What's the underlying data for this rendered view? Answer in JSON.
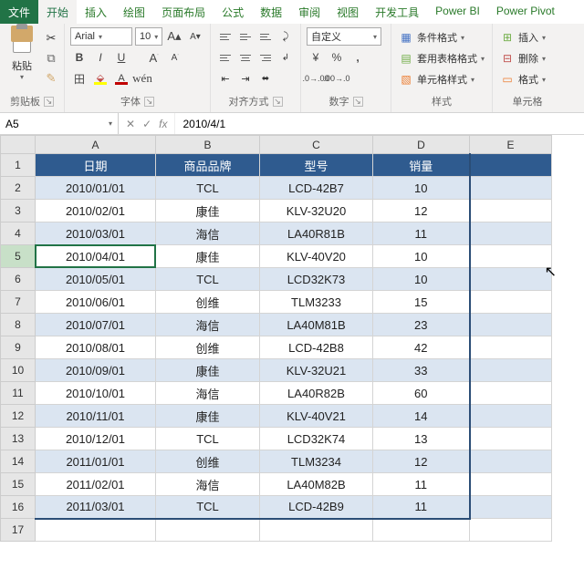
{
  "tabs": {
    "file": "文件",
    "home": "开始",
    "insert": "插入",
    "draw": "绘图",
    "layout": "页面布局",
    "formula": "公式",
    "data": "数据",
    "review": "审阅",
    "view": "视图",
    "dev": "开发工具",
    "pbi": "Power BI",
    "ppivot": "Power Pivot"
  },
  "ribbon": {
    "clipboard": {
      "label": "剪贴板",
      "paste": "粘贴"
    },
    "font": {
      "label": "字体",
      "name": "Arial",
      "size": "10",
      "bold": "B",
      "italic": "I",
      "underline": "U",
      "border": "田",
      "bg": "A",
      "fg": "A",
      "grow": "A",
      "shrink": "A",
      "pinyin": "wén"
    },
    "align": {
      "label": "对齐方式"
    },
    "number": {
      "label": "数字",
      "format": "自定义",
      "pct": "%",
      "comma": ",",
      "inc": ".0",
      "dec": ".00"
    },
    "styles": {
      "label": "样式",
      "cond": "条件格式",
      "tbl": "套用表格格式",
      "cell": "单元格样式"
    },
    "cells": {
      "label": "单元格",
      "insert": "插入",
      "delete": "删除",
      "format": "格式"
    }
  },
  "fx": {
    "ref": "A5",
    "fx": "fx",
    "value": "2010/4/1",
    "x": "✕",
    "chk": "✓"
  },
  "cols": [
    "A",
    "B",
    "C",
    "D",
    "E"
  ],
  "headers": {
    "A": "日期",
    "B": "商品品牌",
    "C": "型号",
    "D": "销量"
  },
  "rows": [
    {
      "n": "2",
      "A": "2010/01/01",
      "B": "TCL",
      "C": "LCD-42B7",
      "D": "10"
    },
    {
      "n": "3",
      "A": "2010/02/01",
      "B": "康佳",
      "C": "KLV-32U20",
      "D": "12"
    },
    {
      "n": "4",
      "A": "2010/03/01",
      "B": "海信",
      "C": "LA40R81B",
      "D": "11"
    },
    {
      "n": "5",
      "A": "2010/04/01",
      "B": "康佳",
      "C": "KLV-40V20",
      "D": "10"
    },
    {
      "n": "6",
      "A": "2010/05/01",
      "B": "TCL",
      "C": "LCD32K73",
      "D": "10"
    },
    {
      "n": "7",
      "A": "2010/06/01",
      "B": "创维",
      "C": "TLM3233",
      "D": "15"
    },
    {
      "n": "8",
      "A": "2010/07/01",
      "B": "海信",
      "C": "LA40M81B",
      "D": "23"
    },
    {
      "n": "9",
      "A": "2010/08/01",
      "B": "创维",
      "C": "LCD-42B8",
      "D": "42"
    },
    {
      "n": "10",
      "A": "2010/09/01",
      "B": "康佳",
      "C": "KLV-32U21",
      "D": "33"
    },
    {
      "n": "11",
      "A": "2010/10/01",
      "B": "海信",
      "C": "LA40R82B",
      "D": "60"
    },
    {
      "n": "12",
      "A": "2010/11/01",
      "B": "康佳",
      "C": "KLV-40V21",
      "D": "14"
    },
    {
      "n": "13",
      "A": "2010/12/01",
      "B": "TCL",
      "C": "LCD32K74",
      "D": "13"
    },
    {
      "n": "14",
      "A": "2011/01/01",
      "B": "创维",
      "C": "TLM3234",
      "D": "12"
    },
    {
      "n": "15",
      "A": "2011/02/01",
      "B": "海信",
      "C": "LA40M82B",
      "D": "11"
    },
    {
      "n": "16",
      "A": "2011/03/01",
      "B": "TCL",
      "C": "LCD-42B9",
      "D": "11"
    }
  ],
  "activeRow": "5",
  "lastEmptyRow": "17"
}
